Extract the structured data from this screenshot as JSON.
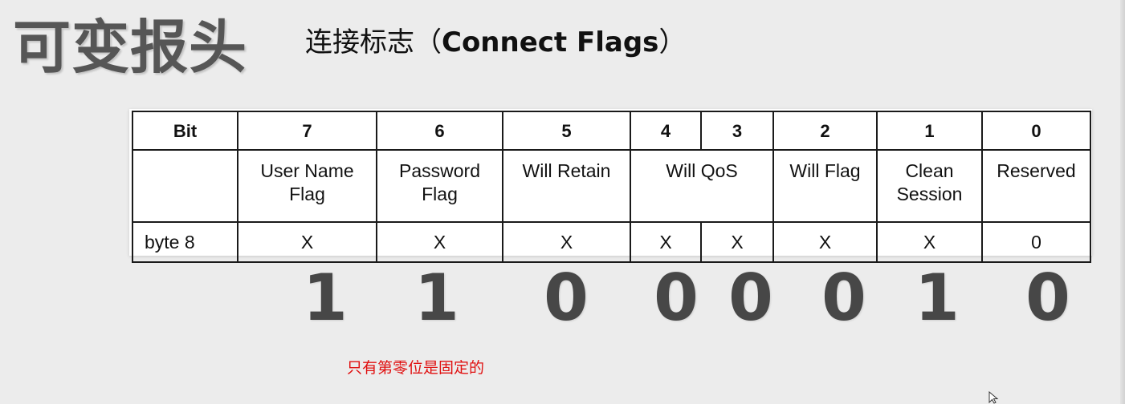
{
  "title": "可变报头",
  "subtitle": {
    "prefix": "连接标志（",
    "english": "Connect Flags",
    "suffix": "）"
  },
  "table": {
    "bit_row": [
      "Bit",
      "7",
      "6",
      "5",
      "4",
      "3",
      "2",
      "1",
      "0"
    ],
    "name_row": {
      "blank": "",
      "user_name_flag": [
        "User Name",
        "Flag"
      ],
      "password_flag": [
        "Password",
        "Flag"
      ],
      "will_retain": "Will Retain",
      "will_qos": "Will QoS",
      "will_flag": "Will Flag",
      "clean_session": [
        "Clean",
        "Session"
      ],
      "reserved": "Reserved"
    },
    "byte_row": [
      "byte 8",
      "X",
      "X",
      "X",
      "X",
      "X",
      "X",
      "X",
      "0"
    ]
  },
  "bit_values": [
    "1",
    "1",
    "0",
    "0",
    "0",
    "0",
    "1",
    "0"
  ],
  "note": "只有第零位是固定的",
  "colors": {
    "title": "#565656",
    "bit_values": "#474747",
    "note": "#e01010"
  },
  "icons": {
    "cursor": "mouse-pointer-icon"
  }
}
